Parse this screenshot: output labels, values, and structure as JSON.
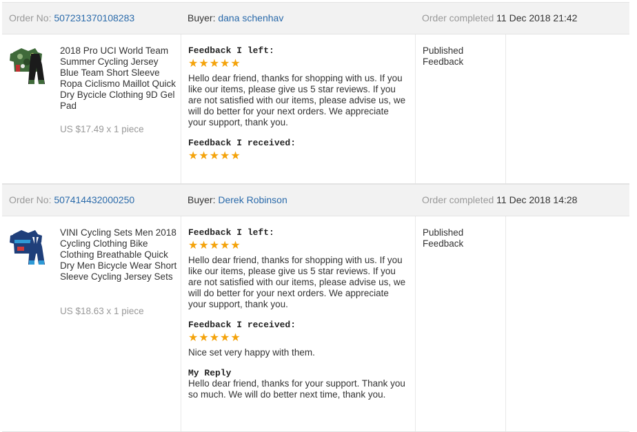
{
  "orders": [
    {
      "order_label": "Order No:",
      "order_no": "507231370108283",
      "buyer_label": "Buyer:",
      "buyer": "dana schenhav",
      "completed_label": "Order completed",
      "completed_date": "11 Dec 2018 21:42",
      "product_title": "2018 Pro UCI World Team Summer Cycling Jersey Blue Team Short Sleeve Ropa Ciclismo Maillot Quick Dry Bycicle Clothing 9D Gel Pad",
      "price": "US $17.49 x 1 piece",
      "feedback_left_label": "Feedback I left:",
      "feedback_left_stars": "★★★★★",
      "feedback_left_text": "Hello dear friend, thanks for shopping with us. If you like our items, please give us 5 star reviews. If you are not satisfied with our items, please advise us, we will do better for your next orders. We appreciate your support, thank you.",
      "feedback_received_label": "Feedback I received:",
      "feedback_received_stars": "★★★★★",
      "status": "Published Feedback"
    },
    {
      "order_label": "Order No:",
      "order_no": "507414432000250",
      "buyer_label": "Buyer:",
      "buyer": "Derek Robinson",
      "completed_label": "Order completed",
      "completed_date": "11 Dec 2018 14:28",
      "product_title": "VINI Cycling Sets Men 2018 Cycling Clothing Bike Clothing Breathable Quick Dry Men Bicycle Wear Short Sleeve Cycling Jersey Sets",
      "price": "US $18.63 x 1 piece",
      "feedback_left_label": "Feedback I left:",
      "feedback_left_stars": "★★★★★",
      "feedback_left_text": "Hello dear friend, thanks for shopping with us. If you like our items, please give us 5 star reviews. If you are not satisfied with our items, please advise us, we will do better for your next orders. We appreciate your support, thank you.",
      "feedback_received_label": "Feedback I received:",
      "feedback_received_stars": "★★★★★",
      "feedback_received_text": "Nice set very happy with them.",
      "reply_label": "My Reply",
      "reply_text": "Hello dear friend, thanks for your support. Thank you so much. We will do better next time, thank you.",
      "status": "Published Feedback"
    }
  ],
  "colors": {
    "link": "#2a6aaa",
    "star": "#f4a30b",
    "header_bg": "#f2f2f2",
    "muted": "#999999"
  },
  "icons": {
    "rating": "star-icon"
  }
}
